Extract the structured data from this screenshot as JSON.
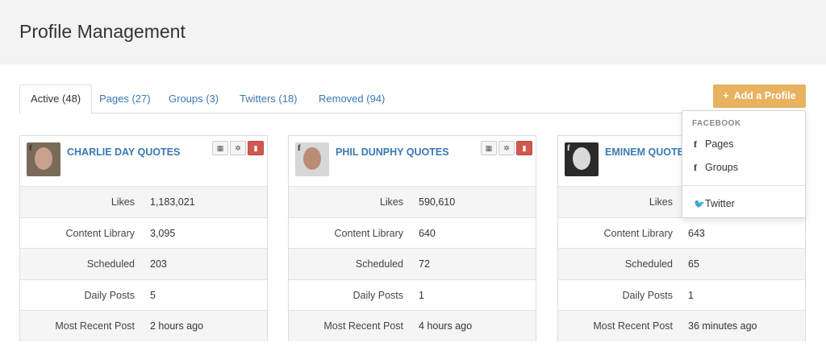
{
  "page": {
    "title": "Profile Management"
  },
  "tabs": [
    {
      "label": "Active (48)",
      "active": true
    },
    {
      "label": "Pages (27)"
    },
    {
      "label": "Groups (3)"
    },
    {
      "label": "Twitters (18)"
    },
    {
      "label": "Removed (94)"
    }
  ],
  "add_button": {
    "label": "Add a Profile",
    "color": "#e8b25f"
  },
  "dropdown": {
    "header": "FACEBOOK",
    "items": [
      {
        "label": "Pages",
        "icon": "facebook-icon"
      },
      {
        "label": "Groups",
        "icon": "facebook-icon"
      },
      {
        "label": "Twitter",
        "icon": "twitter-icon"
      }
    ]
  },
  "stat_labels": [
    "Likes",
    "Content Library",
    "Scheduled",
    "Daily Posts",
    "Most Recent Post"
  ],
  "cards": [
    {
      "name": "CHARLIE DAY QUOTES",
      "stats": [
        "1,183,021",
        "3,095",
        "203",
        "5",
        "2 hours ago"
      ]
    },
    {
      "name": "PHIL DUNPHY QUOTES",
      "stats": [
        "590,610",
        "640",
        "72",
        "1",
        "4 hours ago"
      ]
    },
    {
      "name": "EMINEM QUOTES",
      "stats": [
        "",
        "643",
        "65",
        "1",
        "36 minutes ago"
      ]
    }
  ],
  "colors": {
    "link": "#3a79b5",
    "delete": "#d0584e",
    "header_bg": "#f3f3f3"
  }
}
